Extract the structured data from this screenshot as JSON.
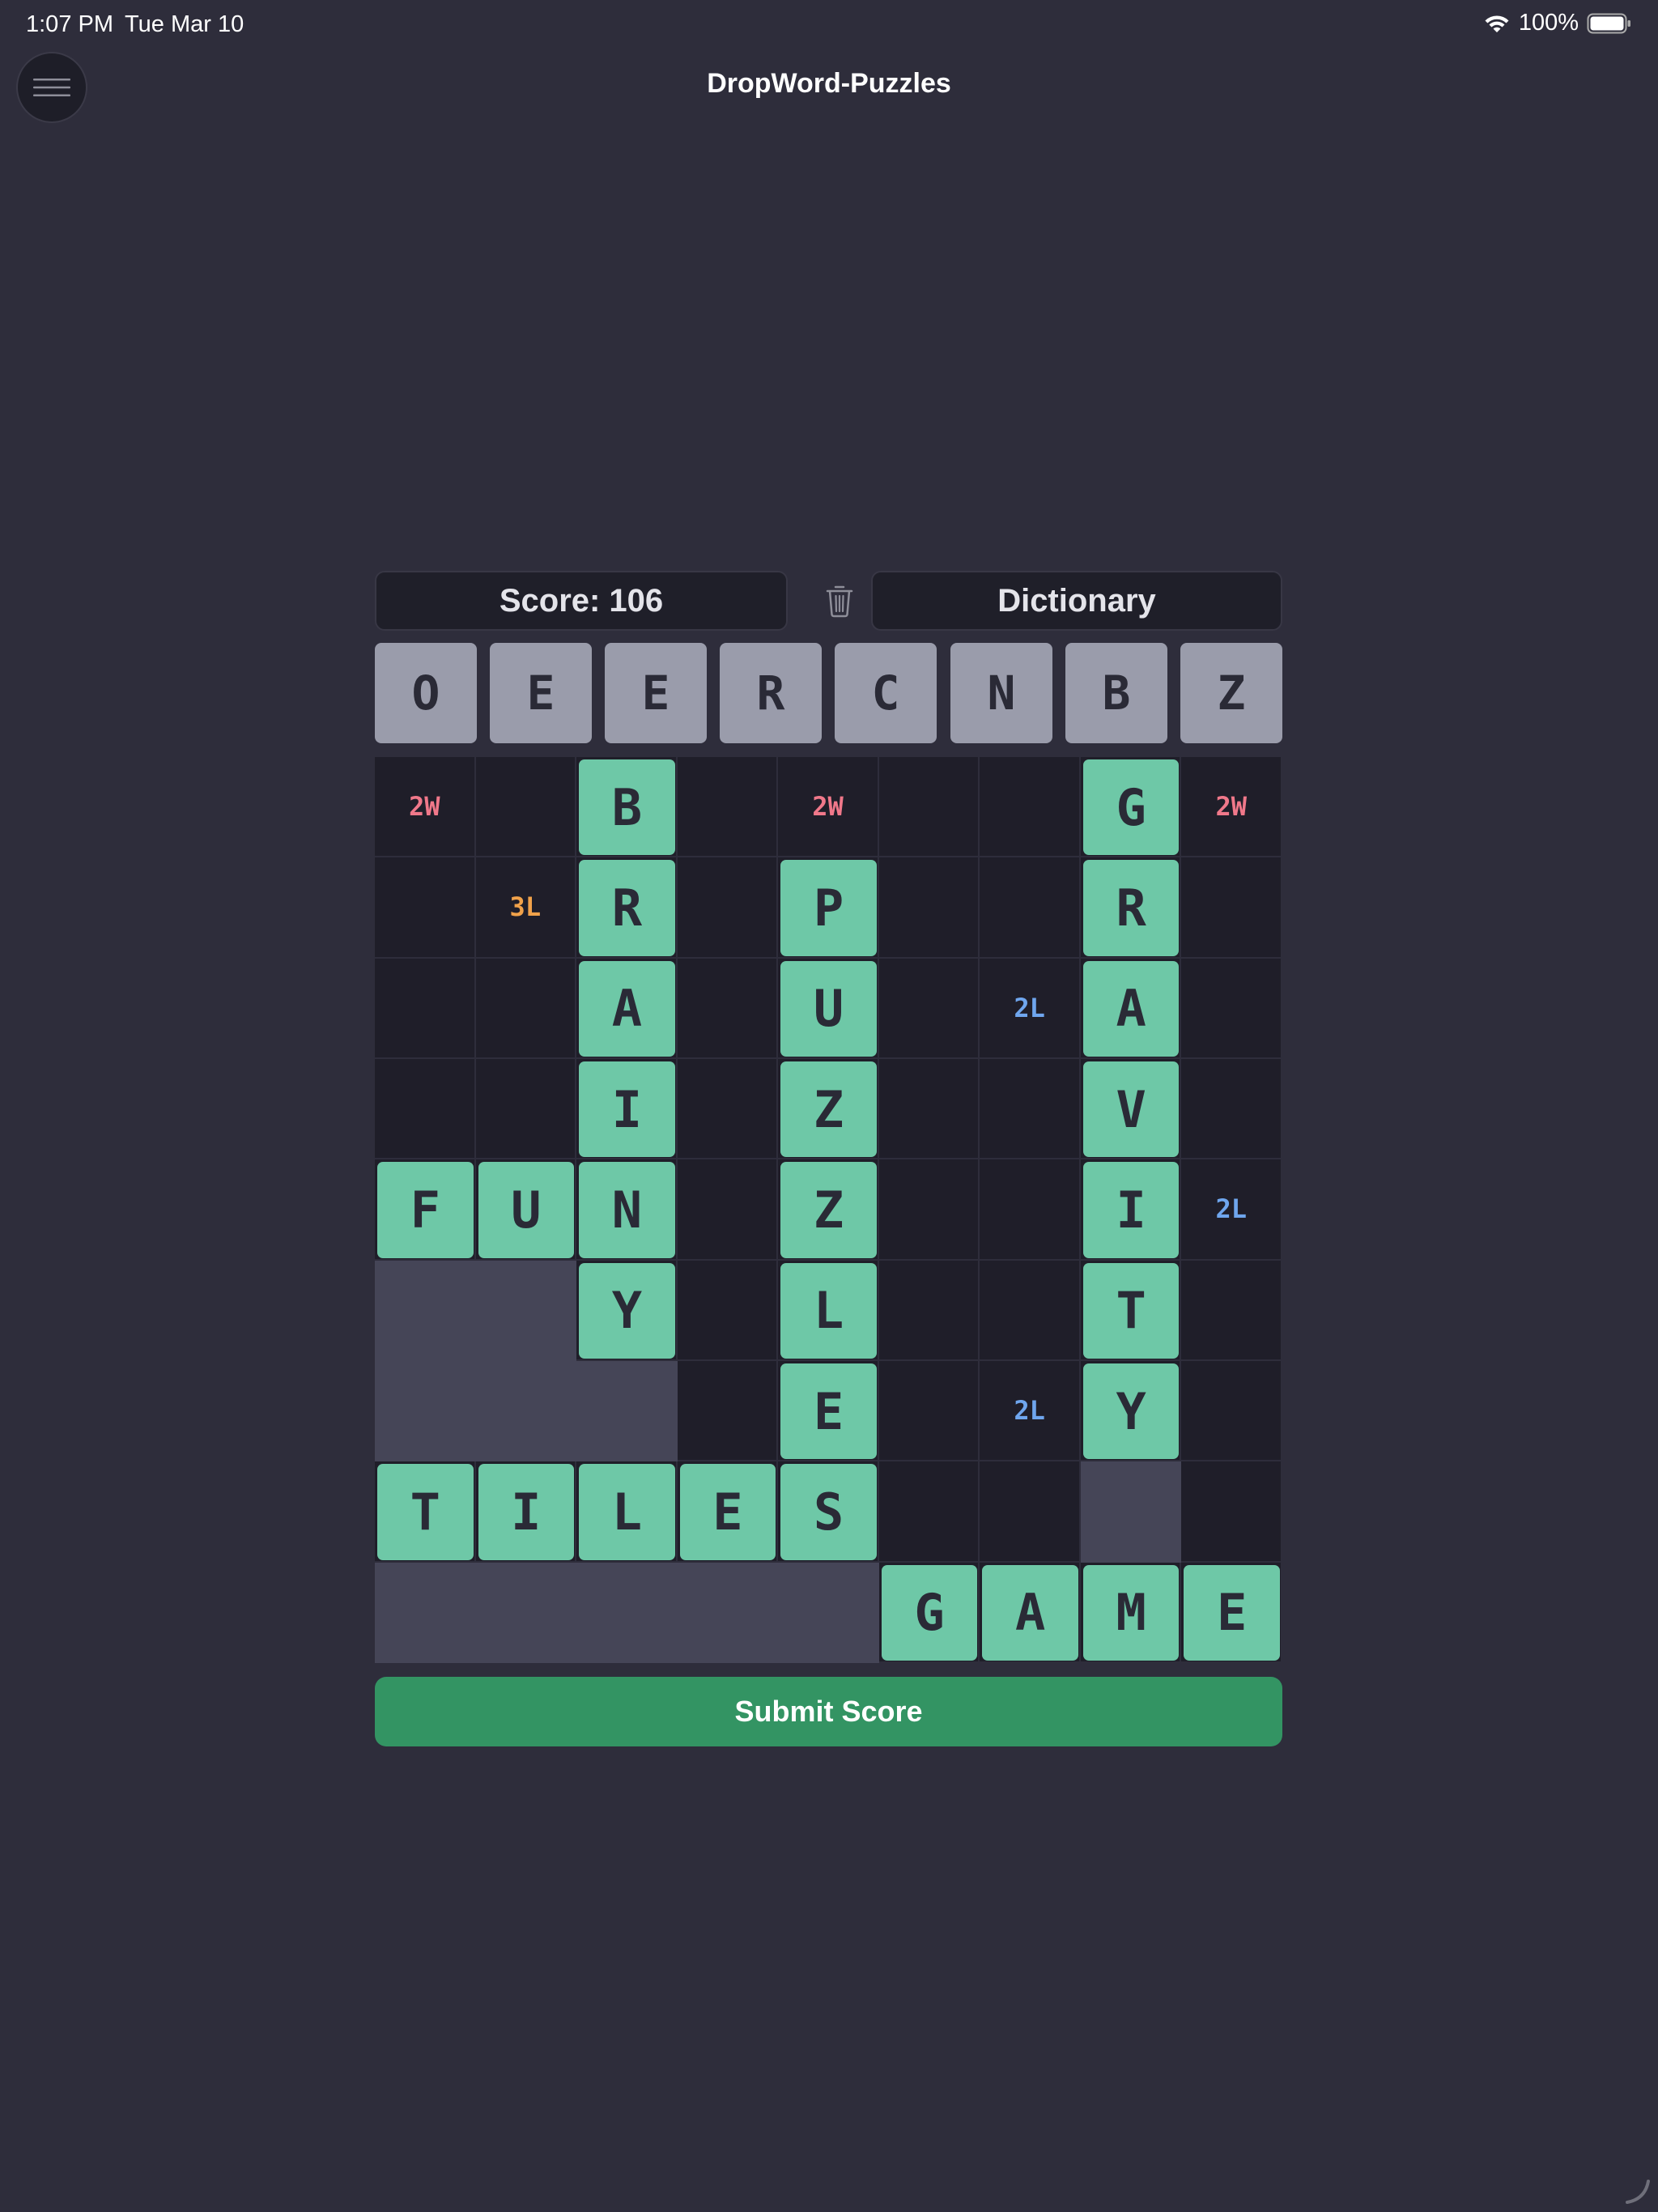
{
  "status_bar": {
    "time": "1:07 PM",
    "date": "Tue Mar 10",
    "battery": "100%"
  },
  "app": {
    "title": "DropWord-Puzzles"
  },
  "controls": {
    "score_label": "Score: 106",
    "dictionary_label": "Dictionary"
  },
  "rack": [
    "O",
    "E",
    "E",
    "R",
    "C",
    "N",
    "B",
    "Z"
  ],
  "board": {
    "size": 9,
    "rows": [
      [
        "2W",
        "",
        "B",
        "",
        "2W",
        "",
        "",
        "G",
        "2W"
      ],
      [
        "",
        "3L",
        "R",
        "",
        "P",
        "",
        "",
        "R",
        ""
      ],
      [
        "",
        "",
        "A",
        "",
        "U",
        "",
        "2L",
        "A",
        ""
      ],
      [
        "",
        "",
        "I",
        "",
        "Z",
        "",
        "",
        "V",
        ""
      ],
      [
        "F",
        "U",
        "N",
        "",
        "Z",
        "",
        "",
        "I",
        "2L"
      ],
      [
        "#",
        "#",
        "Y",
        "",
        "L",
        "",
        "",
        "T",
        ""
      ],
      [
        "#",
        "#",
        "#",
        "",
        "E",
        "",
        "2L",
        "Y",
        ""
      ],
      [
        "T",
        "I",
        "L",
        "E",
        "S",
        "",
        "",
        "#",
        ""
      ],
      [
        "#",
        "#",
        "#",
        "#",
        "#",
        "G",
        "A",
        "M",
        "E"
      ]
    ]
  },
  "submit": {
    "label": "Submit Score"
  },
  "colors": {
    "background": "#2e2d3b",
    "tile": "#6ec8a7",
    "rack_tile": "#9a9cab",
    "submit": "#339463",
    "bonus_2w": "#f0788a",
    "bonus_3l": "#f1a24a",
    "bonus_2l": "#6fa6ee"
  }
}
